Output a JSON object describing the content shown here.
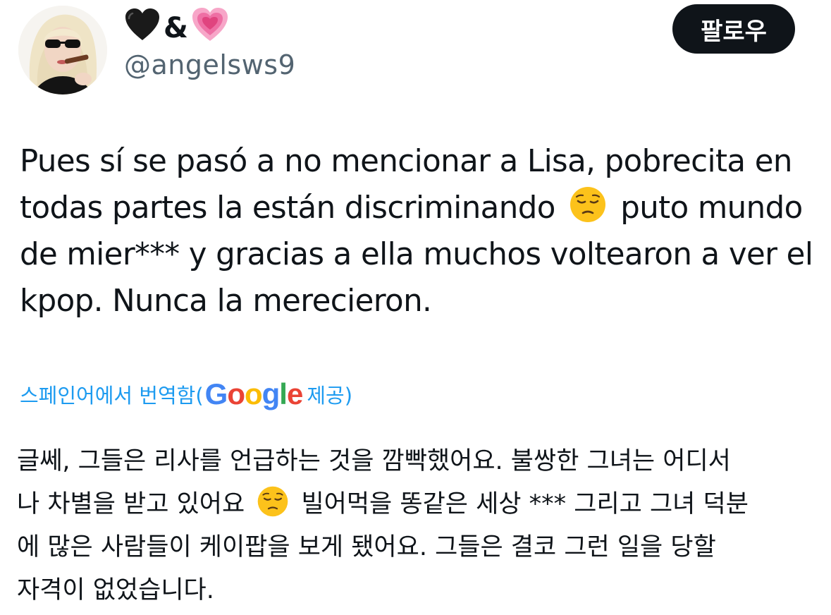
{
  "author": {
    "display_name_parts": [
      "&"
    ],
    "display_name_emoji": [
      "black-heart",
      "growing-heart"
    ],
    "handle": "@angelsws9",
    "avatar_icon": "profile-photo"
  },
  "follow_button": {
    "label": "팔로우"
  },
  "tweet": {
    "lines": [
      "Pues sí se pasó a no mencionar a Lisa, pobrecita en",
      "todas partes la están discriminando",
      "puto mundo",
      "de mier*** y gracias a ella muchos voltearon a ver el",
      "kpop. Nunca la merecieron."
    ],
    "emoji": "pensive-face"
  },
  "translation": {
    "link_text": "스페인어에서 번역함(",
    "provider": "Google",
    "suffix": " 제공)",
    "lines": [
      "글쎄, 그들은 리사를 언급하는 것을 깜빡했어요. 불쌍한 그녀는 어디서",
      "나 차별을 받고 있어요",
      "빌어먹을 똥같은 세상 *** 그리고 그녀 덕분",
      "에 많은 사람들이 케이팝을 보게 됐어요. 그들은 결코 그런 일을 당할",
      "자격이 없었습니다."
    ]
  },
  "colors": {
    "text": "#0f1419",
    "secondary": "#536471",
    "link": "#1d9bf0",
    "button_bg": "#0f1419",
    "button_text": "#ffffff"
  }
}
